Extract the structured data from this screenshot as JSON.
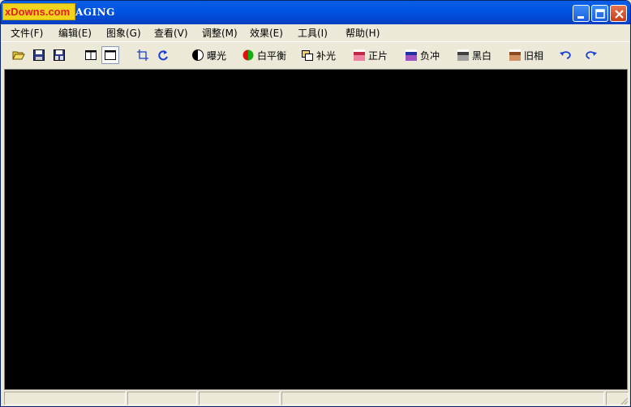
{
  "window": {
    "title": "AGING",
    "logo_text": "xDowns.com"
  },
  "menu": [
    {
      "label": "文件(F)"
    },
    {
      "label": "编辑(E)"
    },
    {
      "label": "图象(G)"
    },
    {
      "label": "查看(V)"
    },
    {
      "label": "调整(M)"
    },
    {
      "label": "效果(E)"
    },
    {
      "label": "工具(I)"
    },
    {
      "label": "帮助(H)"
    }
  ],
  "toolbar": {
    "exposure": "曝光",
    "white_balance": "白平衡",
    "fill_light": "补光",
    "positive": "正片",
    "negative": "负冲",
    "black_white": "黑白",
    "vintage": "旧相"
  },
  "colors": {
    "titlebar": "#0054e3",
    "canvas": "#000000",
    "chrome": "#ece9d8",
    "accent_blue": "#1a3fd0"
  }
}
